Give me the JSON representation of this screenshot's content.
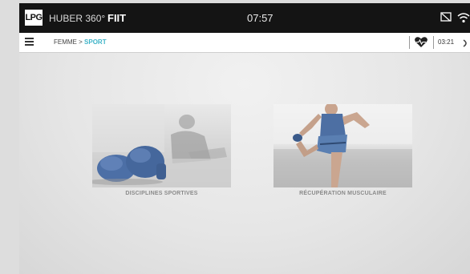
{
  "header": {
    "logo_text": "LPG",
    "brand_prefix": "HUBER 360°",
    "brand_suffix": "FIIT",
    "clock": "07:57"
  },
  "subheader": {
    "breadcrumb_parent": "FEMME",
    "breadcrumb_separator": ">",
    "breadcrumb_current": "SPORT",
    "timer": "03:21"
  },
  "tiles": [
    {
      "label": "DISCIPLINES SPORTIVES",
      "image": "boxing-gloves"
    },
    {
      "label": "RÉCUPÉRATION MUSCULAIRE",
      "image": "athlete-stretching"
    }
  ],
  "colors": {
    "topbar": "#141414",
    "accent": "#3fb4c8",
    "background": "#e6e6e6",
    "glove_blue": "#4c6fa6"
  },
  "icons": [
    "menu-icon",
    "cast-icon",
    "wifi-icon",
    "heart-icon",
    "status-icon"
  ]
}
